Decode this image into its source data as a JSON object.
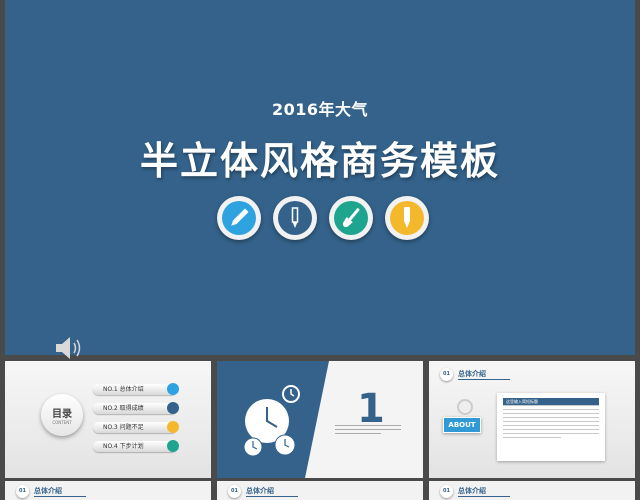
{
  "hero": {
    "subtitle": "2016年大气",
    "title": "半立体风格商务模板",
    "icons": [
      {
        "name": "pencil-icon",
        "color": "#2fa3e0"
      },
      {
        "name": "pen-icon",
        "color": "#34628a"
      },
      {
        "name": "brush-icon",
        "color": "#1ea58f"
      },
      {
        "name": "marker-icon",
        "color": "#f4b82c"
      }
    ]
  },
  "slides": {
    "toc": {
      "title": "目录",
      "subtitle": "CONTENT",
      "items": [
        {
          "label": "NO.1 总体介绍",
          "color": "#2fa3e0"
        },
        {
          "label": "NO.2 取得成绩",
          "color": "#34628a"
        },
        {
          "label": "NO.3 问题不足",
          "color": "#f4b82c"
        },
        {
          "label": "NO.4 下步计划",
          "color": "#1ea58f"
        }
      ]
    },
    "section": {
      "number": "1"
    },
    "about": {
      "section_number": "01",
      "section_title": "总体介绍",
      "card_title": "这里输入简短标题",
      "tag": "ABOUT"
    },
    "bottom_row": [
      {
        "number": "01",
        "title": "总体介绍"
      },
      {
        "number": "01",
        "title": "总体介绍"
      },
      {
        "number": "01",
        "title": "总体介绍"
      }
    ]
  }
}
